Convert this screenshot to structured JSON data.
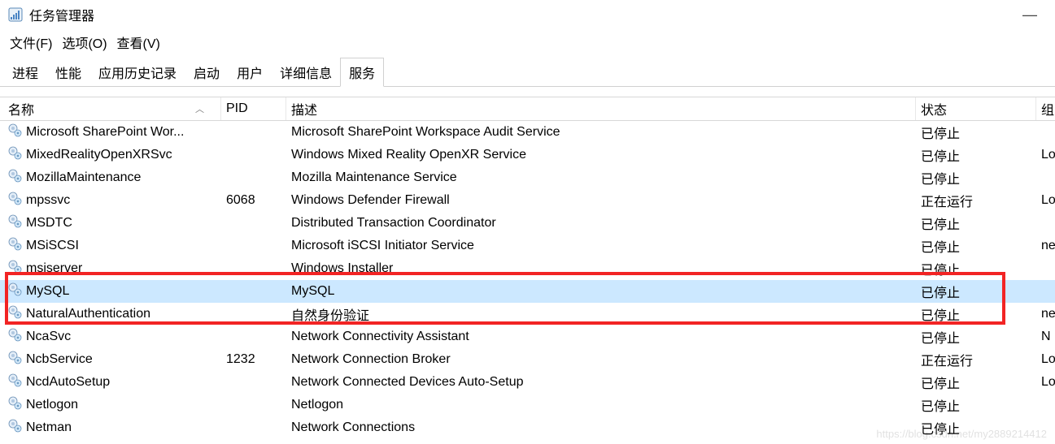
{
  "window": {
    "title": "任务管理器"
  },
  "menu": {
    "file": "文件(F)",
    "options": "选项(O)",
    "view": "查看(V)"
  },
  "tabs": [
    {
      "label": "进程"
    },
    {
      "label": "性能"
    },
    {
      "label": "应用历史记录"
    },
    {
      "label": "启动"
    },
    {
      "label": "用户"
    },
    {
      "label": "详细信息"
    },
    {
      "label": "服务"
    }
  ],
  "columns": {
    "name": "名称",
    "pid": "PID",
    "desc": "描述",
    "status": "状态",
    "group": "组"
  },
  "rows": [
    {
      "name": "Microsoft SharePoint Wor...",
      "pid": "",
      "desc": "Microsoft SharePoint Workspace Audit Service",
      "status": "已停止",
      "group": ""
    },
    {
      "name": "MixedRealityOpenXRSvc",
      "pid": "",
      "desc": "Windows Mixed Reality OpenXR Service",
      "status": "已停止",
      "group": "Lo"
    },
    {
      "name": "MozillaMaintenance",
      "pid": "",
      "desc": "Mozilla Maintenance Service",
      "status": "已停止",
      "group": ""
    },
    {
      "name": "mpssvc",
      "pid": "6068",
      "desc": "Windows Defender Firewall",
      "status": "正在运行",
      "group": "Lo"
    },
    {
      "name": "MSDTC",
      "pid": "",
      "desc": "Distributed Transaction Coordinator",
      "status": "已停止",
      "group": ""
    },
    {
      "name": "MSiSCSI",
      "pid": "",
      "desc": "Microsoft iSCSI Initiator Service",
      "status": "已停止",
      "group": "ne"
    },
    {
      "name": "msiserver",
      "pid": "",
      "desc": "Windows Installer",
      "status": "已停止",
      "group": ""
    },
    {
      "name": "MySQL",
      "pid": "",
      "desc": "MySQL",
      "status": "已停止",
      "group": ""
    },
    {
      "name": "NaturalAuthentication",
      "pid": "",
      "desc": "自然身份验证",
      "status": "已停止",
      "group": "ne"
    },
    {
      "name": "NcaSvc",
      "pid": "",
      "desc": "Network Connectivity Assistant",
      "status": "已停止",
      "group": "N"
    },
    {
      "name": "NcbService",
      "pid": "1232",
      "desc": "Network Connection Broker",
      "status": "正在运行",
      "group": "Lo"
    },
    {
      "name": "NcdAutoSetup",
      "pid": "",
      "desc": "Network Connected Devices Auto-Setup",
      "status": "已停止",
      "group": "Lo"
    },
    {
      "name": "Netlogon",
      "pid": "",
      "desc": "Netlogon",
      "status": "已停止",
      "group": ""
    },
    {
      "name": "Netman",
      "pid": "",
      "desc": "Network Connections",
      "status": "已停止",
      "group": ""
    }
  ],
  "selected_index": 7,
  "watermark": "https://blog.csdn.net/my2889214412"
}
